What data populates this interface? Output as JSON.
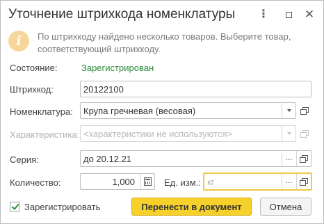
{
  "window": {
    "title": "Уточнение штрихкода номенклатуры",
    "more_icon": "more-vertical-icon",
    "maximize_icon": "maximize-icon",
    "close_icon": "close-icon"
  },
  "info": {
    "icon": "info-icon",
    "message": "По штрихкоду найдено несколько товаров. Выберите товар, соответствующий штрихкоду."
  },
  "status": {
    "label": "Состояние:",
    "value": "Зарегистрирован",
    "color": "#2e8b3a"
  },
  "barcode": {
    "label": "Штрихкод:",
    "value": "20122100"
  },
  "nomenclature": {
    "label": "Номенклатура:",
    "value": "Крупа гречневая (весовая)"
  },
  "characteristic": {
    "label": "Характеристика:",
    "placeholder": "<характеристики не используются>"
  },
  "series": {
    "label": "Серия:",
    "value": "до 20.12.21",
    "select_glyph": "..."
  },
  "quantity": {
    "label": "Количество:",
    "value": "1,000",
    "calc_icon": "calculator-icon"
  },
  "unit": {
    "label": "Ед. изм.:",
    "placeholder": "кг",
    "select_glyph": "..."
  },
  "register_checkbox": {
    "label": "Зарегистрировать",
    "checked": true
  },
  "buttons": {
    "primary": "Перенести в документ",
    "cancel": "Отмена",
    "accent_color": "#f6d12c"
  }
}
